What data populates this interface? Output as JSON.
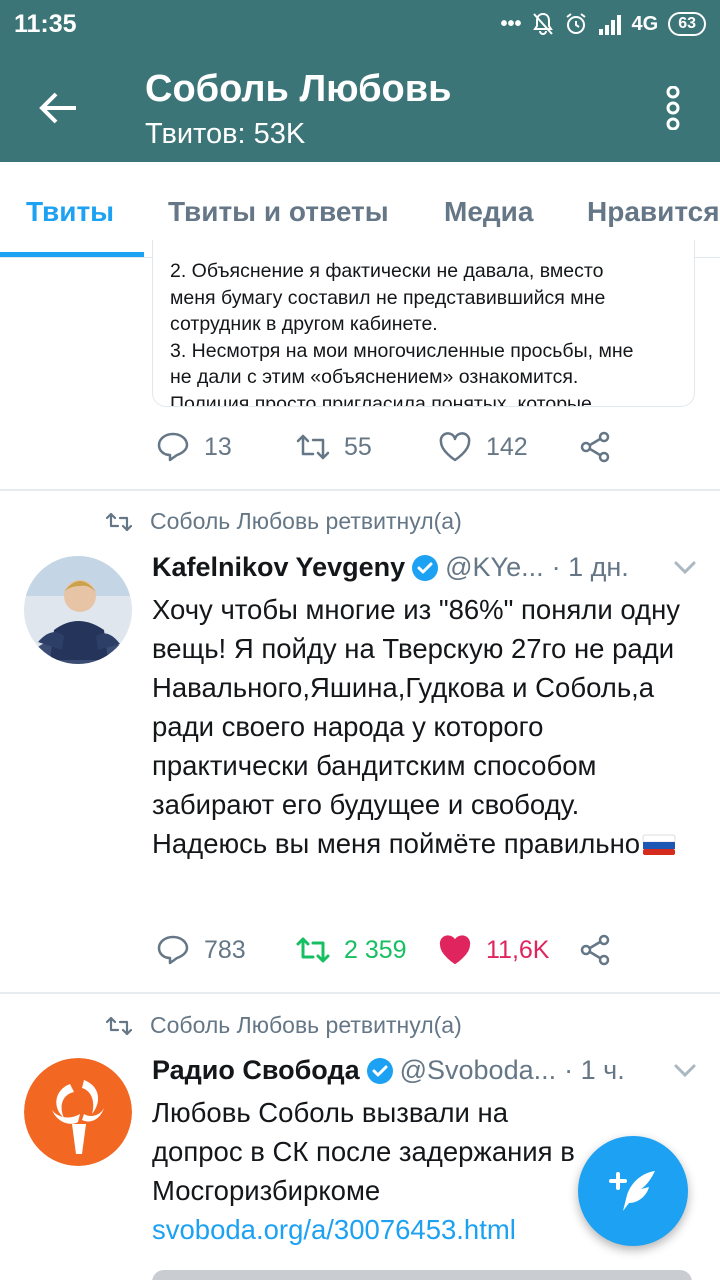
{
  "status_bar": {
    "time": "11:35",
    "network": "4G",
    "battery": "63"
  },
  "app_bar": {
    "title": "Соболь Любовь",
    "subtitle": "Твитов: 53K"
  },
  "tabs": [
    {
      "label": "Твиты",
      "active": true
    },
    {
      "label": "Твиты и ответы",
      "active": false
    },
    {
      "label": "Медиа",
      "active": false
    },
    {
      "label": "Нравится",
      "active": false
    }
  ],
  "quoted_card": {
    "text": "2. Объяснение я фактически не давала, вместо\nменя бумагу составил не представившийся мне\nсотрудник в другом кабинете.\n3. Несмотря на мои многочисленные просьбы, мне\nне дали с этим «объяснением» ознакомится.\nПолиция просто пригласила понятых, которые"
  },
  "tweets": [
    {
      "stats": {
        "replies": "13",
        "retweets": "55",
        "likes": "142"
      }
    },
    {
      "retweet_label": "Соболь Любовь ретвитнул(а)",
      "name": "Kafelnikov Yevgeny",
      "handle": "@KYe...",
      "time": "· 1 дн.",
      "text": "Хочу чтобы многие из \"86%\" поняли одну вещь! Я пойду на Тверскую 27го не ради Навального,Яшина,Гудкова и Соболь,а ради своего народа у которого практически бандитским способом забирают его будущее и свободу. Надеюсь вы меня поймёте правильно",
      "stats": {
        "replies": "783",
        "retweets": "2 359",
        "likes": "11,6K"
      }
    },
    {
      "retweet_label": "Соболь Любовь ретвитнул(а)",
      "name": "Радио Свобода",
      "handle": "@Svoboda...",
      "time": "· 1 ч.",
      "text": "Любовь Соболь вызвали на допрос в СК после задержания в Мосгоризбиркоме ",
      "link": "svoboda.org/a/30076453.html"
    }
  ],
  "colors": {
    "app_bar": "#3c7578",
    "accent": "#1da1f2",
    "retweet_green": "#17bf63",
    "like_red": "#e0245e",
    "secondary_text": "#657786"
  },
  "icons": [
    "back-arrow-icon",
    "more-vert-icon",
    "reply-icon",
    "retweet-icon",
    "like-icon",
    "share-icon",
    "verified-icon",
    "chevron-down-icon",
    "compose-tweet-icon"
  ]
}
